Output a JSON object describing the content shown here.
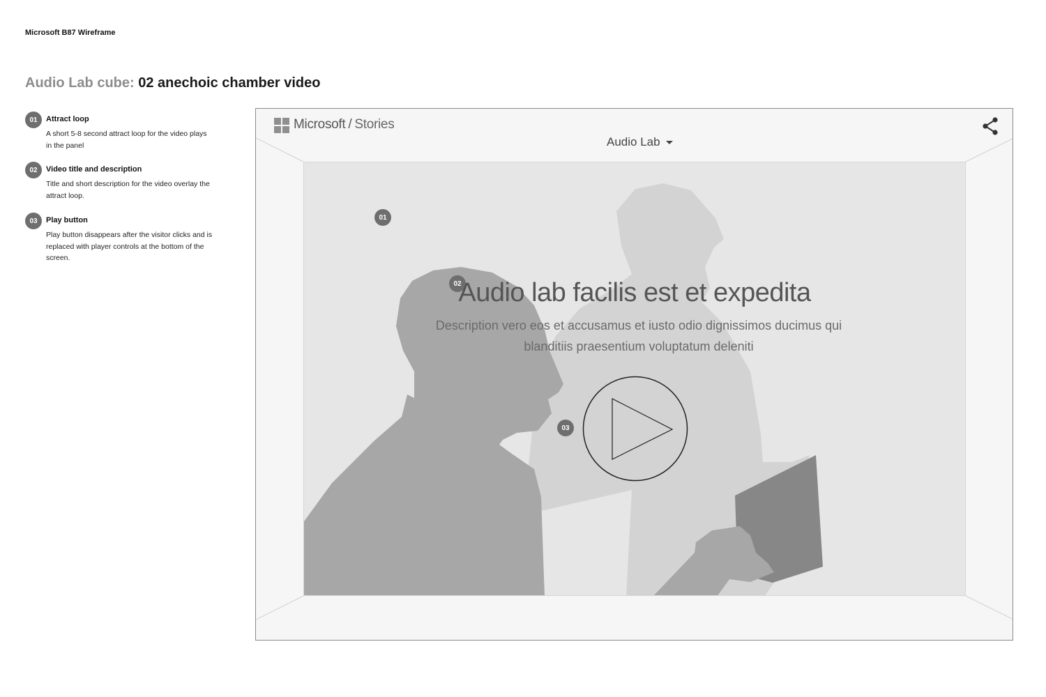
{
  "doc_label": "Microsoft B87 Wireframe",
  "title": {
    "prefix": "Audio Lab cube:",
    "main": "02 anechoic chamber video"
  },
  "notes": [
    {
      "num": "01",
      "title": "Attract loop",
      "desc": "A short 5-8 second attract loop for the video plays in the panel"
    },
    {
      "num": "02",
      "title": "Video title and description",
      "desc": "Title and short description for the video overlay the attract loop."
    },
    {
      "num": "03",
      "title": "Play button",
      "desc": "Play button disappears after the visitor clicks and is replaced with player controls at the bottom of the screen."
    }
  ],
  "mockup": {
    "brand": "Microsoft",
    "separator": "/",
    "section": "Stories",
    "dropdown_label": "Audio Lab",
    "share_icon": "share-icon",
    "video": {
      "title": "Audio lab facilis est et expedita",
      "description": "Description vero eos et accusamus et iusto odio dignissimos ducimus qui blanditiis praesentium voluptatum deleniti",
      "play_icon": "play-icon"
    },
    "callouts": [
      "01",
      "02",
      "03"
    ]
  },
  "colors": {
    "badge": "#6e6e6e",
    "panel": "#e6e6e6",
    "frame": "#f6f6f6"
  }
}
